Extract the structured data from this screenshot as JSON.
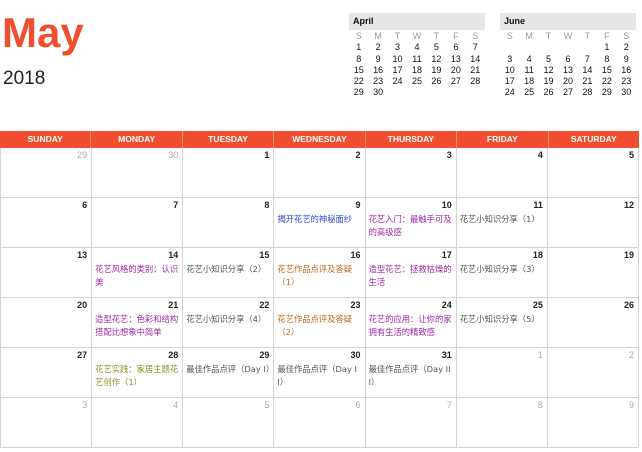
{
  "title": {
    "month": "May",
    "year": "2018"
  },
  "mini_calendars": [
    {
      "key": "april",
      "name": "April",
      "dow": [
        "S",
        "M",
        "T",
        "W",
        "T",
        "F",
        "S"
      ],
      "weeks": [
        [
          "",
          "1",
          "2",
          "3",
          "4",
          "5",
          "6",
          "7"
        ],
        [
          "",
          "8",
          "9",
          "10",
          "11",
          "12",
          "13",
          "14"
        ],
        [
          "",
          "15",
          "16",
          "17",
          "18",
          "19",
          "20",
          "21"
        ],
        [
          "",
          "22",
          "23",
          "24",
          "25",
          "26",
          "27",
          "28"
        ],
        [
          "",
          "29",
          "30",
          "",
          "",
          "",
          "",
          ""
        ]
      ]
    },
    {
      "key": "june",
      "name": "June",
      "dow": [
        "S",
        "M",
        "T",
        "W",
        "T",
        "F",
        "S"
      ],
      "weeks": [
        [
          "",
          "",
          "",
          "",
          "",
          "",
          "1",
          "2"
        ],
        [
          "",
          "3",
          "4",
          "5",
          "6",
          "7",
          "8",
          "9"
        ],
        [
          "",
          "10",
          "11",
          "12",
          "13",
          "14",
          "15",
          "16"
        ],
        [
          "",
          "17",
          "18",
          "19",
          "20",
          "21",
          "22",
          "23"
        ],
        [
          "",
          "24",
          "25",
          "26",
          "27",
          "28",
          "29",
          "30"
        ]
      ]
    }
  ],
  "weekdays": [
    "SUNDAY",
    "MONDAY",
    "TUESDAY",
    "WEDNESDAY",
    "THURSDAY",
    "FRIDAY",
    "SATURDAY"
  ],
  "colors": {
    "accent": "#f04e2e",
    "grid": "#d4d4d4",
    "muted": "#aaaaaa",
    "event_blue": "#2b4bd6",
    "event_purple": "#a126a6",
    "event_orange": "#c2661a",
    "event_gray": "#555555",
    "event_olive": "#8b8f1a"
  },
  "weeks": [
    [
      {
        "day": "29",
        "other": true
      },
      {
        "day": "30",
        "other": true
      },
      {
        "day": "1"
      },
      {
        "day": "2"
      },
      {
        "day": "3"
      },
      {
        "day": "4"
      },
      {
        "day": "5"
      }
    ],
    [
      {
        "day": "6"
      },
      {
        "day": "7"
      },
      {
        "day": "8"
      },
      {
        "day": "9",
        "event": "揭开花艺的神秘面纱",
        "color": "event_blue"
      },
      {
        "day": "10",
        "event": "花艺入门：最触手可及的高级感",
        "color": "event_purple"
      },
      {
        "day": "11",
        "event": "花艺小知识分享（1）",
        "color": "event_gray"
      },
      {
        "day": "12"
      }
    ],
    [
      {
        "day": "13"
      },
      {
        "day": "14",
        "event": "花艺风格的类别：认识美",
        "color": "event_purple"
      },
      {
        "day": "15",
        "event": "花艺小知识分享（2）",
        "color": "event_gray"
      },
      {
        "day": "16",
        "event": "花艺作品点评及答疑（1）",
        "color": "event_orange"
      },
      {
        "day": "17",
        "event": "造型花艺：拯救枯燥的生活",
        "color": "event_purple"
      },
      {
        "day": "18",
        "event": "花艺小知识分享（3）",
        "color": "event_gray"
      },
      {
        "day": "19"
      }
    ],
    [
      {
        "day": "20"
      },
      {
        "day": "21",
        "event": "造型花艺：色彩和结构搭配比想象中简单",
        "color": "event_purple"
      },
      {
        "day": "22",
        "event": "花艺小知识分享（4）",
        "color": "event_gray"
      },
      {
        "day": "23",
        "event": "花艺作品点评及答疑（2）",
        "color": "event_orange"
      },
      {
        "day": "24",
        "event": "花艺的应用：让你的家拥有生活的精致感",
        "color": "event_purple"
      },
      {
        "day": "25",
        "event": "花艺小知识分享（5）",
        "color": "event_gray"
      },
      {
        "day": "26"
      }
    ],
    [
      {
        "day": "27"
      },
      {
        "day": "28",
        "event": "花艺实践：家居主题花艺创作（1）",
        "color": "event_olive"
      },
      {
        "day": "29",
        "event": "最佳作品点评（Day I）",
        "color": "event_gray"
      },
      {
        "day": "30",
        "event": "最佳作品点评（Day II）",
        "color": "event_gray"
      },
      {
        "day": "31",
        "event": "最佳作品点评（Day III）",
        "color": "event_gray"
      },
      {
        "day": "1",
        "other": true
      },
      {
        "day": "2",
        "other": true
      }
    ],
    [
      {
        "day": "3",
        "other": true
      },
      {
        "day": "4",
        "other": true
      },
      {
        "day": "5",
        "other": true
      },
      {
        "day": "6",
        "other": true
      },
      {
        "day": "7",
        "other": true
      },
      {
        "day": "8",
        "other": true
      },
      {
        "day": "9",
        "other": true
      }
    ]
  ]
}
